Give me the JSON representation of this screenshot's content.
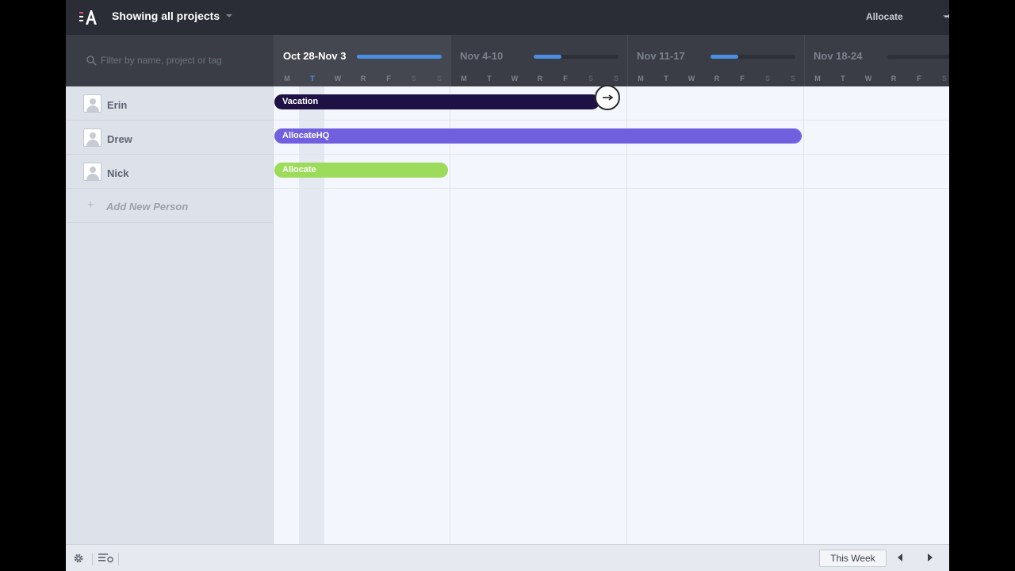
{
  "topbar": {
    "logo_icon": "allocate-logo-icon",
    "project_filter_label": "Showing all projects",
    "account_label": "Allocate"
  },
  "filter": {
    "placeholder": "Filter by name, project or tag",
    "value": ""
  },
  "weeks": [
    {
      "label": "Oct 28-Nov 3",
      "utilization": 1.0,
      "current": true
    },
    {
      "label": "Nov 4-10",
      "utilization": 0.33,
      "current": false
    },
    {
      "label": "Nov 11-17",
      "utilization": 0.33,
      "current": false
    },
    {
      "label": "Nov 18-24",
      "utilization": 0.0,
      "current": false
    }
  ],
  "day_letters": [
    "M",
    "T",
    "W",
    "R",
    "F",
    "S",
    "S"
  ],
  "today_index": 1,
  "people": [
    {
      "name": "Erin"
    },
    {
      "name": "Drew"
    },
    {
      "name": "Nick"
    }
  ],
  "add_person_label": "Add New Person",
  "assignments": [
    {
      "person": "Erin",
      "label": "Vacation",
      "color": "#1e1245",
      "start_day": 0,
      "days": 13
    },
    {
      "person": "Drew",
      "label": "AllocateHQ",
      "color": "#7060e0",
      "start_day": 0,
      "days": 21
    },
    {
      "person": "Nick",
      "label": "Allocate",
      "color": "#9ddb5a",
      "start_day": 0,
      "days": 7
    }
  ],
  "footer": {
    "this_week_label": "This Week",
    "settings_icon": "gear-icon",
    "view_icon": "view-list-icon",
    "prev_icon": "chevron-left-icon",
    "next_icon": "chevron-right-icon"
  },
  "colors": {
    "accent": "#4a90e2",
    "topbar": "#2a2d35",
    "header": "#3a3d45"
  }
}
